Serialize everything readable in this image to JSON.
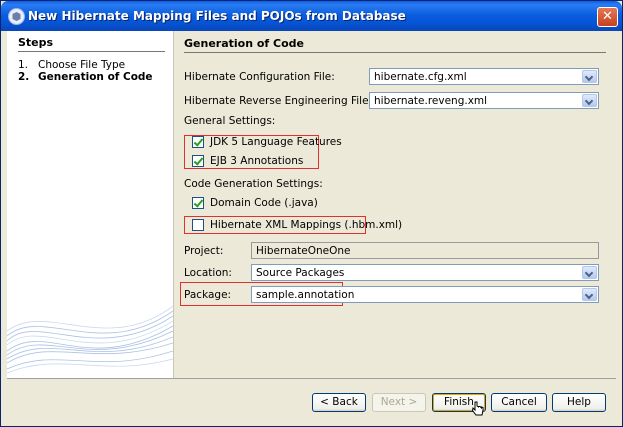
{
  "window": {
    "title": "New Hibernate Mapping Files and POJOs from Database",
    "close_glyph": "✕"
  },
  "steps": {
    "heading": "Steps",
    "items": [
      {
        "num": "1.",
        "label": "Choose File Type"
      },
      {
        "num": "2.",
        "label": "Generation of Code"
      }
    ]
  },
  "main": {
    "heading": "Generation of Code",
    "config_file": {
      "label": "Hibernate Configuration File:",
      "value": "hibernate.cfg.xml"
    },
    "reveng_file": {
      "label": "Hibernate Reverse Engineering File:",
      "value": "hibernate.reveng.xml"
    },
    "general_settings": {
      "label": "General Settings:",
      "jdk5": {
        "label": "JDK 5 Language Features",
        "checked": true
      },
      "ejb3": {
        "label": "EJB 3 Annotations",
        "checked": true
      }
    },
    "code_gen_settings": {
      "label": "Code Generation Settings:",
      "domain_code": {
        "label": "Domain Code (.java)",
        "checked": true
      },
      "xml_mappings": {
        "label": "Hibernate XML Mappings (.hbm.xml)",
        "checked": false
      }
    },
    "project": {
      "label": "Project:",
      "value": "HibernateOneOne"
    },
    "location": {
      "label": "Location:",
      "value": "Source Packages"
    },
    "package": {
      "label": "Package:",
      "value": "sample.annotation"
    }
  },
  "buttons": {
    "back": "< Back",
    "next": "Next >",
    "finish": "Finish",
    "cancel": "Cancel",
    "help": "Help"
  },
  "colors": {
    "title_bar": "#0653d4",
    "highlight": "#e03030",
    "dialog_bg": "#ece9d8"
  }
}
